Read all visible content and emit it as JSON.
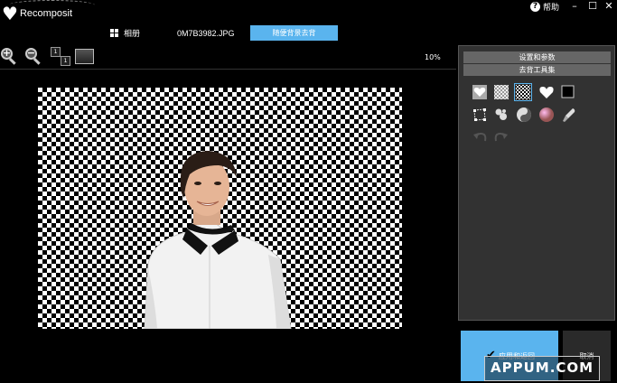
{
  "app": {
    "logo_text": "Recomposit",
    "help_label": "帮助"
  },
  "window_controls": {
    "minimize": "–",
    "maximize": "☐",
    "close": "✕"
  },
  "tabs": {
    "album": "相册",
    "file": "0M7B3982.JPG",
    "active": "随便背景去背"
  },
  "toolbar": {
    "zoom_in": "+",
    "zoom_out": "−",
    "actual_size": [
      "1",
      "1"
    ],
    "zoom_level": "10%"
  },
  "panel": {
    "settings_header": "设置和参数",
    "tools_header": "去背工具集"
  },
  "buttons": {
    "apply_label": "应用和返回",
    "cancel_label": "取消"
  },
  "watermark": "APPUM.COM",
  "colors": {
    "accent": "#5ab4ee",
    "panel_bg": "#323232",
    "panel_header": "#666666"
  }
}
